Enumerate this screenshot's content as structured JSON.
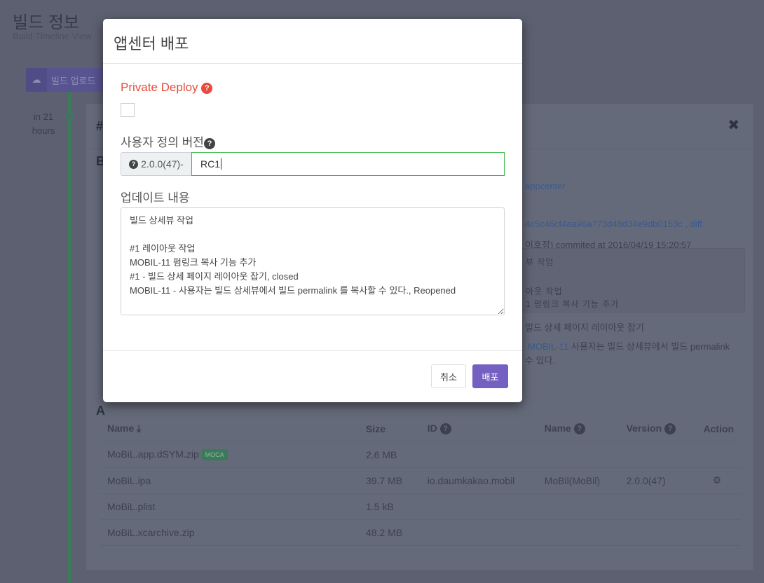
{
  "page": {
    "title": "빌드 정보",
    "subtitle": "Build Timeline View",
    "upload_label": "빌드 업로드",
    "time": "in 21 hours"
  },
  "card": {
    "hash": "#",
    "build_title": "B",
    "repo_link": "appcenter",
    "commit_hash": "4c5c46cf4aa96a773d48d34e9db0153c",
    "diff": ", diff",
    "committer": "이호정) commited at 2016/04/19 15:20:57",
    "commit_lines": [
      "뷰 작업",
      "",
      "아웃 작업",
      "1 펌링크 복사 기능 추가"
    ],
    "issue1": "빌드 상세 페이지 레이아웃 잡기",
    "issue2_link": "MOBIL-11",
    "issue2": " 사용자는 빌드 상세뷰에서 빌드 permalink",
    "issue2b": "수 있다.",
    "artifacts_title": "A"
  },
  "table": {
    "headers": [
      "Name",
      "Size",
      "ID",
      "Name",
      "Version",
      "Action"
    ],
    "rows": [
      {
        "name": "MoBiL.app.dSYM.zip",
        "badge": "MOCA",
        "size": "2.6 MB",
        "id": "",
        "app": "",
        "version": ""
      },
      {
        "name": "MoBiL.ipa",
        "badge": "",
        "size": "39.7 MB",
        "id": "io.daumkakao.mobil",
        "app": "MoBil(MoBil)",
        "version": "2.0.0(47)",
        "action": "gear-icon"
      },
      {
        "name": "MoBiL.plist",
        "badge": "",
        "size": "1.5 kB",
        "id": "",
        "app": "",
        "version": ""
      },
      {
        "name": "MoBiL.xcarchive.zip",
        "badge": "",
        "size": "48.2 MB",
        "id": "",
        "app": "",
        "version": ""
      }
    ]
  },
  "modal": {
    "title": "앱센터 배포",
    "private_label": "Private Deploy",
    "private_checked": false,
    "version_label": "사용자 정의 버전",
    "version_prefix": "2.0.0(47)-",
    "version_value": "RC1",
    "notes_label": "업데이트 내용",
    "notes_value": "빌드 상세뷰 작업\n\n#1 레이아웃 작업\nMOBIL-11 펌링크 복사 기능 추가\n#1 - 빌드 상세 페이지 레이아웃 잡기, closed\nMOBIL-11 - 사용자는 빌드 상세뷰에서 빌드 permalink 를 복사할 수 있다., Reopened",
    "cancel": "취소",
    "deploy": "배포"
  },
  "colors": {
    "accent": "#7460c0",
    "danger": "#e74c3c",
    "success": "#3fae5c"
  }
}
